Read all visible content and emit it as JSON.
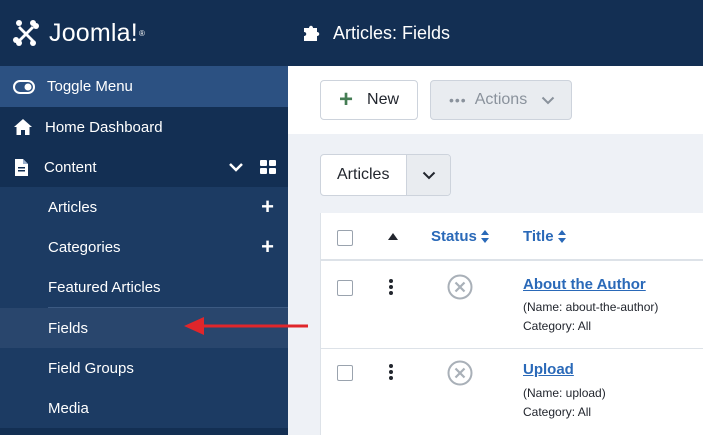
{
  "brand": {
    "name": "Joomla!",
    "logo_icon": "joomla-logo-icon"
  },
  "sidebar": {
    "toggle": {
      "label": "Toggle Menu",
      "icon": "toggle-icon"
    },
    "home": {
      "label": "Home Dashboard",
      "icon": "home-icon"
    },
    "content": {
      "label": "Content",
      "icon": "file-icon",
      "chevron": "chevron-down-icon",
      "grid": "grid-icon"
    },
    "items": [
      {
        "label": "Articles",
        "has_add": true
      },
      {
        "label": "Categories",
        "has_add": true
      },
      {
        "label": "Featured Articles",
        "has_add": false
      },
      {
        "label": "Fields",
        "has_add": false,
        "active": true
      },
      {
        "label": "Field Groups",
        "has_add": false
      },
      {
        "label": "Media",
        "has_add": false
      }
    ],
    "add_symbol": "+"
  },
  "header": {
    "title": "Articles: Fields",
    "icon": "puzzle-icon"
  },
  "toolbar": {
    "new_label": "New",
    "new_symbol": "+",
    "actions_label": "Actions",
    "actions_dots": "•••"
  },
  "filter": {
    "context_value": "Articles"
  },
  "table": {
    "columns": {
      "status": "Status",
      "title": "Title"
    },
    "rows": [
      {
        "title": "About the Author",
        "name": "(Name: about-the-author)",
        "category": "Category: All"
      },
      {
        "title": "Upload",
        "name": "(Name: upload)",
        "category": "Category: All"
      }
    ]
  },
  "annotation": {
    "arrow_color": "#e0262b",
    "points_to": "Fields"
  },
  "colors": {
    "sidebar_bg": "#132f53",
    "accent_blue": "#2a69b8",
    "new_green": "#457d54"
  }
}
